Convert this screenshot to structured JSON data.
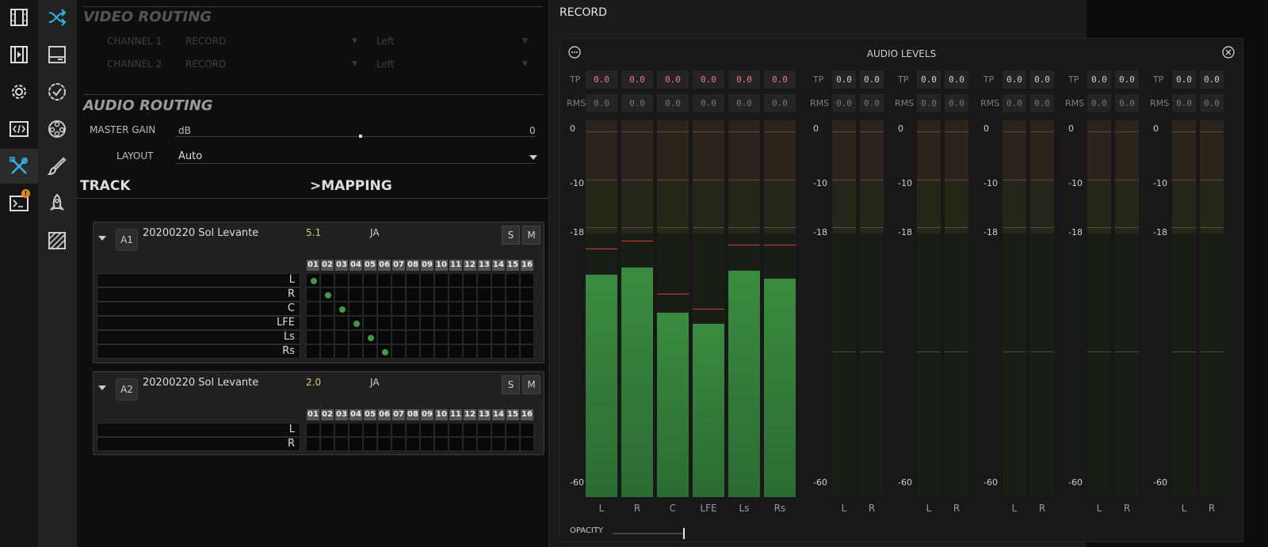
{
  "rail1_icons": [
    "film-icon",
    "clip-icon",
    "gear-icon",
    "code-icon",
    "tools-icon",
    "console-icon"
  ],
  "rail2_icons": [
    "shuffle-icon",
    "panel-icon",
    "badge-check-icon",
    "reel-icon",
    "brush-icon",
    "rocket-icon",
    "hatch-icon"
  ],
  "console_badge": "!",
  "accent_color": "#2fb4e6",
  "video_routing": {
    "title": "VIDEO ROUTING",
    "rows": [
      {
        "label": "CHANNEL 1",
        "source": "RECORD",
        "side": "Left"
      },
      {
        "label": "CHANNEL 2",
        "source": "RECORD",
        "side": "Left"
      }
    ]
  },
  "audio_routing": {
    "title": "AUDIO ROUTING",
    "master_gain_label": "MASTER GAIN",
    "gain_unit": "dB",
    "gain_value": "0",
    "layout_label": "LAYOUT",
    "layout_value": "Auto"
  },
  "track_header": {
    "track": "TRACK",
    "mapping": ">MAPPING"
  },
  "tracks": [
    {
      "tag": "A1",
      "name": "20200220 Sol Levante",
      "format": "5.1",
      "lang": "JA",
      "solo": "S",
      "mute": "M",
      "channels": [
        "L",
        "R",
        "C",
        "LFE",
        "Ls",
        "Rs"
      ],
      "mapping": [
        1,
        2,
        3,
        4,
        5,
        6
      ]
    },
    {
      "tag": "A2",
      "name": "20200220 Sol Levante",
      "format": "2.0",
      "lang": "JA",
      "solo": "S",
      "mute": "M",
      "channels": [
        "L",
        "R"
      ],
      "mapping": [
        0,
        0
      ]
    }
  ],
  "grid_columns": [
    "01",
    "02",
    "03",
    "04",
    "05",
    "06",
    "07",
    "08",
    "09",
    "10",
    "11",
    "12",
    "13",
    "14",
    "15",
    "16"
  ],
  "record_panel": {
    "title": "RECORD"
  },
  "audio_levels": {
    "title": "AUDIO LEVELS",
    "tp_label": "TP",
    "rms_label": "RMS",
    "scale": [
      "0",
      "-10",
      "-18",
      "-60"
    ],
    "opacity_label": "OPACITY",
    "opacity_value": 0.95,
    "groups": [
      {
        "channels": [
          "L",
          "R",
          "C",
          "LFE",
          "Ls",
          "Rs"
        ],
        "tp": [
          "0.0",
          "0.0",
          "0.0",
          "0.0",
          "0.0",
          "0.0"
        ],
        "rms": [
          "0.0",
          "0.0",
          "0.0",
          "0.0",
          "0.0",
          "0.0"
        ],
        "levels": [
          0.59,
          0.61,
          0.49,
          0.46,
          0.6,
          0.58
        ],
        "peaks": [
          0.66,
          0.68,
          0.54,
          0.5,
          0.67,
          0.67
        ]
      },
      {
        "channels": [
          "L",
          "R"
        ],
        "tp": [
          "0.0",
          "0.0"
        ],
        "rms": [
          "0.0",
          "0.0"
        ],
        "levels": [
          0,
          0
        ],
        "peaks": [
          0,
          0
        ]
      },
      {
        "channels": [
          "L",
          "R"
        ],
        "tp": [
          "0.0",
          "0.0"
        ],
        "rms": [
          "0.0",
          "0.0"
        ],
        "levels": [
          0,
          0
        ],
        "peaks": [
          0,
          0
        ]
      },
      {
        "channels": [
          "L",
          "R"
        ],
        "tp": [
          "0.0",
          "0.0"
        ],
        "rms": [
          "0.0",
          "0.0"
        ],
        "levels": [
          0,
          0
        ],
        "peaks": [
          0,
          0
        ]
      },
      {
        "channels": [
          "L",
          "R"
        ],
        "tp": [
          "0.0",
          "0.0"
        ],
        "rms": [
          "0.0",
          "0.0"
        ],
        "levels": [
          0,
          0
        ],
        "peaks": [
          0,
          0
        ]
      },
      {
        "channels": [
          "L",
          "R"
        ],
        "tp": [
          "0.0",
          "0.0"
        ],
        "rms": [
          "0.0",
          "0.0"
        ],
        "levels": [
          0,
          0
        ],
        "peaks": [
          0,
          0
        ]
      }
    ]
  }
}
